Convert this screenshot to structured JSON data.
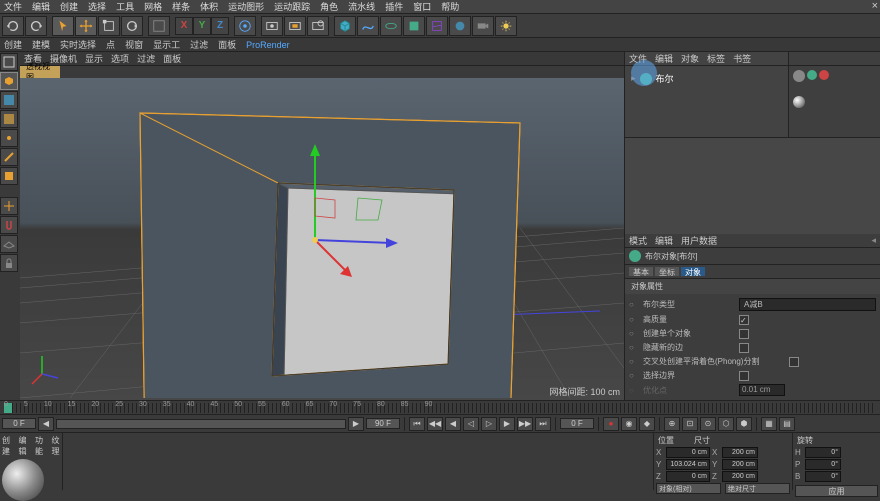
{
  "menubar": {
    "items": [
      "文件",
      "编辑",
      "创建",
      "选择",
      "工具",
      "网格",
      "样条",
      "体积",
      "运动图形",
      "运动跟踪",
      "角色",
      "流水线",
      "插件",
      "窗口",
      "帮助"
    ]
  },
  "axis": {
    "x": "X",
    "y": "Y",
    "z": "Z"
  },
  "submenu": {
    "items": [
      "创建",
      "建模",
      "实时选择",
      "点",
      "视窗",
      "显示工",
      "过滤",
      "面板"
    ],
    "mode": "ProRender"
  },
  "vp_header": {
    "items": [
      "查看",
      "摄像机",
      "显示",
      "选项",
      "过滤",
      "面板"
    ],
    "title": "透视视图"
  },
  "vp_footer": "网格间距: 100 cm",
  "objects": {
    "tabs": [
      "文件",
      "编辑",
      "对象",
      "标签",
      "书签"
    ],
    "item": {
      "name": "布尔"
    }
  },
  "attr": {
    "tabs": [
      "模式",
      "编辑",
      "用户数据"
    ],
    "title": "布尔对象[布尔]",
    "subtabs": [
      "基本",
      "坐标",
      "对象"
    ],
    "section": "对象属性",
    "rows": [
      {
        "label": "布尔类型",
        "value": "A减B"
      },
      {
        "label": "高质量",
        "checked": true
      },
      {
        "label": "创建单个对象",
        "checked": false
      },
      {
        "label": "隐藏新的边",
        "checked": false
      },
      {
        "label": "交叉处创建平滑着色(Phong)分割",
        "checked": false
      },
      {
        "label": "选择边界",
        "checked": false
      },
      {
        "label": "优化点",
        "value": "0.01 cm",
        "dim": true
      }
    ]
  },
  "timeline": {
    "start": "0 F",
    "end": "90 F",
    "ticks": [
      "0",
      "5",
      "10",
      "15",
      "20",
      "25",
      "30",
      "35",
      "40",
      "45",
      "50",
      "55",
      "60",
      "65",
      "70",
      "75",
      "80",
      "85",
      "90"
    ]
  },
  "material": {
    "tabs": [
      "创建",
      "编辑",
      "功能",
      "纹理"
    ]
  },
  "coords": {
    "head": [
      "位置",
      "尺寸",
      "旋转"
    ],
    "x": {
      "p": "0 cm",
      "s": "200 cm",
      "h": "0°"
    },
    "y": {
      "p": "103.024 cm",
      "s": "200 cm",
      "p2": "0°"
    },
    "z": {
      "p": "0 cm",
      "s": "200 cm",
      "b": "0°"
    },
    "apply": "应用",
    "obj_label": "对象(相对)",
    "abs_label": "绝对尺寸"
  }
}
